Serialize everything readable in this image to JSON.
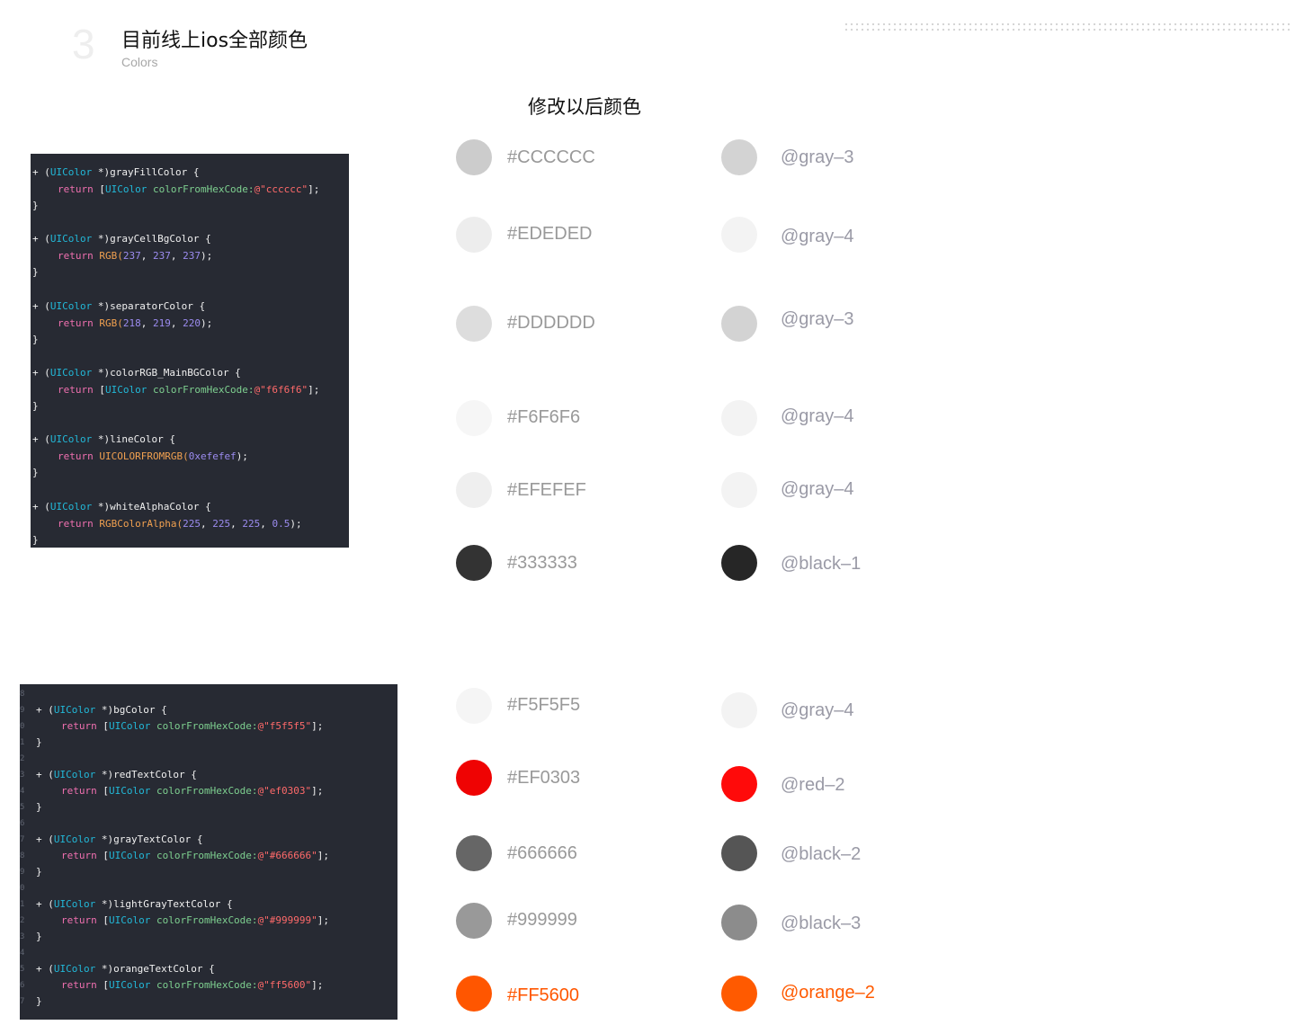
{
  "section": {
    "number": "3",
    "title": "目前线上ios全部颜色",
    "subtitle": "Colors"
  },
  "column_header": "修改以后颜色",
  "code_block_1": {
    "methods": [
      {
        "name": "grayFillColor",
        "return": [
          "[",
          "UIColor",
          " ",
          "colorFromHexCode:",
          "@\"cccccc\"",
          "];"
        ]
      },
      {
        "name": "grayCellBgColor",
        "return": [
          "RGB(",
          "237",
          ", ",
          "237",
          ", ",
          "237",
          ");"
        ]
      },
      {
        "name": "separatorColor",
        "return": [
          "RGB(",
          "218",
          ", ",
          "219",
          ", ",
          "220",
          ");"
        ]
      },
      {
        "name": "colorRGB_MainBGColor",
        "return": [
          "[",
          "UIColor",
          " ",
          "colorFromHexCode:",
          "@\"f6f6f6\"",
          "];"
        ]
      },
      {
        "name": "lineColor",
        "return": [
          "UICOLORFROMRGB(",
          "0xefefef",
          ");"
        ]
      },
      {
        "name": "whiteAlphaColor",
        "return": [
          "RGBColorAlpha(",
          "225",
          ", ",
          "225",
          ", ",
          "225",
          ", ",
          "0.5",
          ");"
        ]
      }
    ]
  },
  "code_block_2": {
    "gutter": [
      "8",
      "9",
      "0",
      "1",
      "2",
      "3",
      "4",
      "5",
      "6",
      "7",
      "8",
      "9",
      "0",
      "1",
      "2",
      "3",
      "4",
      "5",
      "6",
      "7"
    ],
    "methods": [
      {
        "name": "bgColor",
        "hex": "@\"f5f5f5\""
      },
      {
        "name": "redTextColor",
        "hex": "@\"ef0303\""
      },
      {
        "name": "grayTextColor",
        "hex": "@\"#666666\""
      },
      {
        "name": "lightGrayTextColor",
        "hex": "@\"#999999\""
      },
      {
        "name": "orangeTextColor",
        "hex": "@\"ff5600\""
      }
    ]
  },
  "code_tokens": {
    "plus": "+ ",
    "open_paren": "(",
    "class": "UIColor",
    "star": " *)",
    "brace_open": " {",
    "return_kw": "return ",
    "brace_close": "}"
  },
  "colors": [
    {
      "hex": "#CCCCCC",
      "swatch": "#cccccc",
      "token": "@gray–3",
      "token_swatch": "#d3d3d3",
      "label_color": "#999999",
      "token_color": "#9a9aa6"
    },
    {
      "hex": "#EDEDED",
      "swatch": "#ededed",
      "token": "@gray–4",
      "token_swatch": "#f3f3f3",
      "label_color": "#999999",
      "token_color": "#9a9aa6"
    },
    {
      "hex": "#DDDDDD",
      "swatch": "#dddddd",
      "token": "@gray–3",
      "token_swatch": "#d3d3d3",
      "label_color": "#999999",
      "token_color": "#9a9aa6"
    },
    {
      "hex": "#F6F6F6",
      "swatch": "#f6f6f6",
      "token": "@gray–4",
      "token_swatch": "#f3f3f3",
      "label_color": "#999999",
      "token_color": "#9a9aa6"
    },
    {
      "hex": "#EFEFEF",
      "swatch": "#efefef",
      "token": "@gray–4",
      "token_swatch": "#f3f3f3",
      "label_color": "#999999",
      "token_color": "#9a9aa6"
    },
    {
      "hex": "#333333",
      "swatch": "#333333",
      "token": "@black–1",
      "token_swatch": "#262626",
      "label_color": "#999999",
      "token_color": "#9a9aa6"
    },
    {
      "hex": "#F5F5F5",
      "swatch": "#f5f5f5",
      "token": "@gray–4",
      "token_swatch": "#f3f3f3",
      "label_color": "#999999",
      "token_color": "#9a9aa6"
    },
    {
      "hex": "#EF0303",
      "swatch": "#ef0303",
      "token": "@red–2",
      "token_swatch": "#ff0a0a",
      "label_color": "#999999",
      "token_color": "#9a9aa6"
    },
    {
      "hex": "#666666",
      "swatch": "#666666",
      "token": "@black–2",
      "token_swatch": "#555555",
      "label_color": "#999999",
      "token_color": "#9a9aa6"
    },
    {
      "hex": "#999999",
      "swatch": "#999999",
      "token": "@black–3",
      "token_swatch": "#8c8c8c",
      "label_color": "#999999",
      "token_color": "#9a9aa6"
    },
    {
      "hex": "#FF5600",
      "swatch": "#ff5600",
      "token": "@orange–2",
      "token_swatch": "#ff5a00",
      "label_color": "#ff5600",
      "token_color": "#ff5a00"
    }
  ]
}
